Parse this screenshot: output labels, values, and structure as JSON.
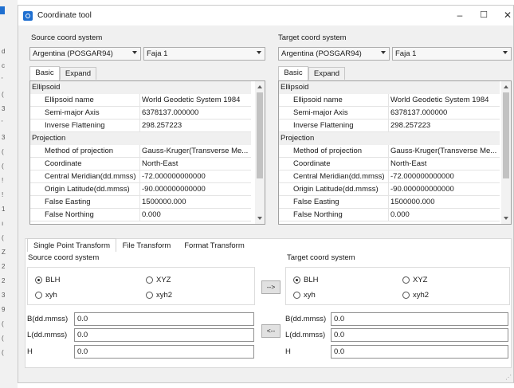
{
  "window": {
    "title": "Coordinate tool",
    "controls": {
      "minimize": "–",
      "maximize": "☐",
      "close": "✕"
    }
  },
  "background_chars": [
    "d",
    "c",
    "'",
    "(",
    "3",
    "'",
    "3",
    "(",
    "(",
    "!",
    "!",
    "1",
    "ı",
    "(",
    "Z",
    "2",
    "2",
    "3",
    "9",
    "(",
    "(",
    "("
  ],
  "source": {
    "section_label": "Source coord system",
    "datum": "Argentina (POSGAR94)",
    "zone": "Faja 1",
    "tabs": [
      "Basic",
      "Expand"
    ],
    "props": [
      {
        "cat": true,
        "k": "Ellipsoid"
      },
      {
        "k": "Ellipsoid name",
        "v": "World Geodetic System 1984"
      },
      {
        "k": "Semi-major Axis",
        "v": "6378137.000000"
      },
      {
        "k": "Inverse Flattening",
        "v": "298.257223"
      },
      {
        "cat": true,
        "k": "Projection"
      },
      {
        "k": "Method of projection",
        "v": "Gauss-Kruger(Transverse Me..."
      },
      {
        "k": "Coordinate",
        "v": "North-East"
      },
      {
        "k": "Central Meridian(dd.mmss)",
        "v": "-72.000000000000"
      },
      {
        "k": "Origin Latitude(dd.mmss)",
        "v": "-90.000000000000"
      },
      {
        "k": "False Easting",
        "v": "1500000.000"
      },
      {
        "k": "False Northing",
        "v": "0.000"
      }
    ]
  },
  "target": {
    "section_label": "Target coord system",
    "datum": "Argentina (POSGAR94)",
    "zone": "Faja 1",
    "tabs": [
      "Basic",
      "Expand"
    ],
    "props": [
      {
        "cat": true,
        "k": "Ellipsoid"
      },
      {
        "k": "Ellipsoid name",
        "v": "World Geodetic System 1984"
      },
      {
        "k": "Semi-major Axis",
        "v": "6378137.000000"
      },
      {
        "k": "Inverse Flattening",
        "v": "298.257223"
      },
      {
        "cat": true,
        "k": "Projection"
      },
      {
        "k": "Method of projection",
        "v": "Gauss-Kruger(Transverse Me..."
      },
      {
        "k": "Coordinate",
        "v": "North-East"
      },
      {
        "k": "Central Meridian(dd.mmss)",
        "v": "-72.000000000000"
      },
      {
        "k": "Origin Latitude(dd.mmss)",
        "v": "-90.000000000000"
      },
      {
        "k": "False Easting",
        "v": "1500000.000"
      },
      {
        "k": "False Northing",
        "v": "0.000"
      }
    ]
  },
  "bottom": {
    "tabs": [
      "Single Point Transform",
      "File Transform",
      "Format Transform"
    ],
    "source_label": "Source coord system",
    "target_label": "Target coord system",
    "radios": {
      "blh": "BLH",
      "xyz": "XYZ",
      "xyh": "xyh",
      "xyh2": "xyh2"
    },
    "src_selected": "BLH",
    "tgt_selected": "BLH",
    "fields": [
      {
        "label": "B(dd.mmss)",
        "value": "0.0"
      },
      {
        "label": "L(dd.mmss)",
        "value": "0.0"
      },
      {
        "label": "H",
        "value": "0.0"
      }
    ],
    "tgt_fields": [
      {
        "label": "B(dd.mmss)",
        "value": "0.0"
      },
      {
        "label": "L(dd.mmss)",
        "value": "0.0"
      },
      {
        "label": "H",
        "value": "0.0"
      }
    ],
    "forward_button": "-->",
    "back_button": "<--"
  }
}
